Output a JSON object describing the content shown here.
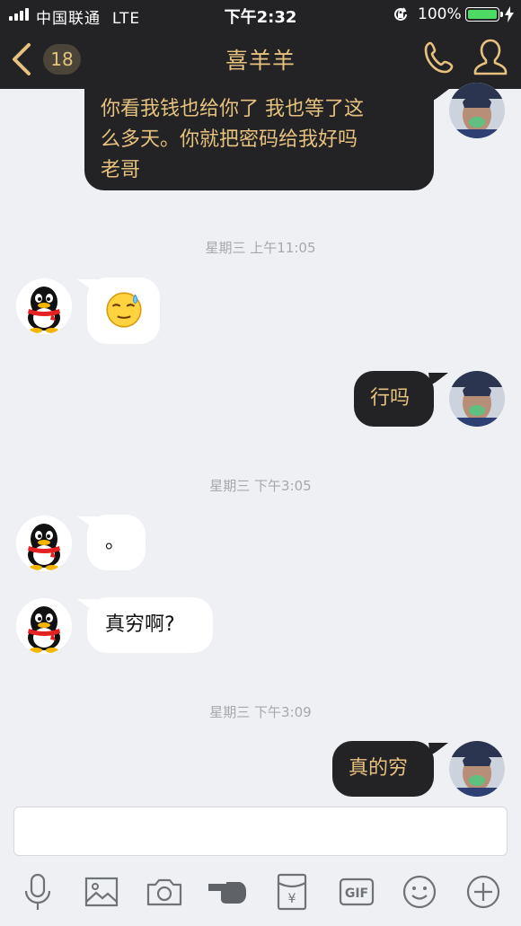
{
  "status_bar": {
    "carrier": "中国联通",
    "network": "LTE",
    "time": "下午2:32",
    "battery_percent": "100%",
    "battery_level": 1.0
  },
  "nav": {
    "unread_count": "18",
    "title": "喜羊羊",
    "icons": [
      "back-chevron-icon",
      "phone-icon",
      "profile-icon"
    ]
  },
  "messages": [
    {
      "side": "out",
      "text_lines": [
        "你看我钱也给你了 我也等了这",
        "么多天。你就把密码给我好吗",
        "老哥"
      ]
    },
    {
      "type": "time",
      "text": "星期三 上午11:05"
    },
    {
      "side": "in",
      "emoji": "sweat-smile-emoji"
    },
    {
      "side": "out",
      "text": "行吗"
    },
    {
      "type": "time",
      "text": "星期三 下午3:05"
    },
    {
      "side": "in",
      "text": "。"
    },
    {
      "side": "in",
      "text": "真穷啊?"
    },
    {
      "type": "time",
      "text": "星期三 下午3:09"
    },
    {
      "side": "out",
      "text": "真的穷"
    }
  ],
  "input": {
    "value": "",
    "placeholder": ""
  },
  "toolbar": {
    "icons": [
      "microphone-icon",
      "image-icon",
      "camera-icon",
      "poke-hand-icon",
      "red-packet-icon",
      "gif-icon",
      "emoji-icon",
      "plus-icon"
    ],
    "gif_label": "GIF",
    "red_packet_label": "¥"
  },
  "colors": {
    "dark": "#232325",
    "gold": "#e7c27f",
    "background": "#eef0f4",
    "battery_green": "#4cd964"
  }
}
